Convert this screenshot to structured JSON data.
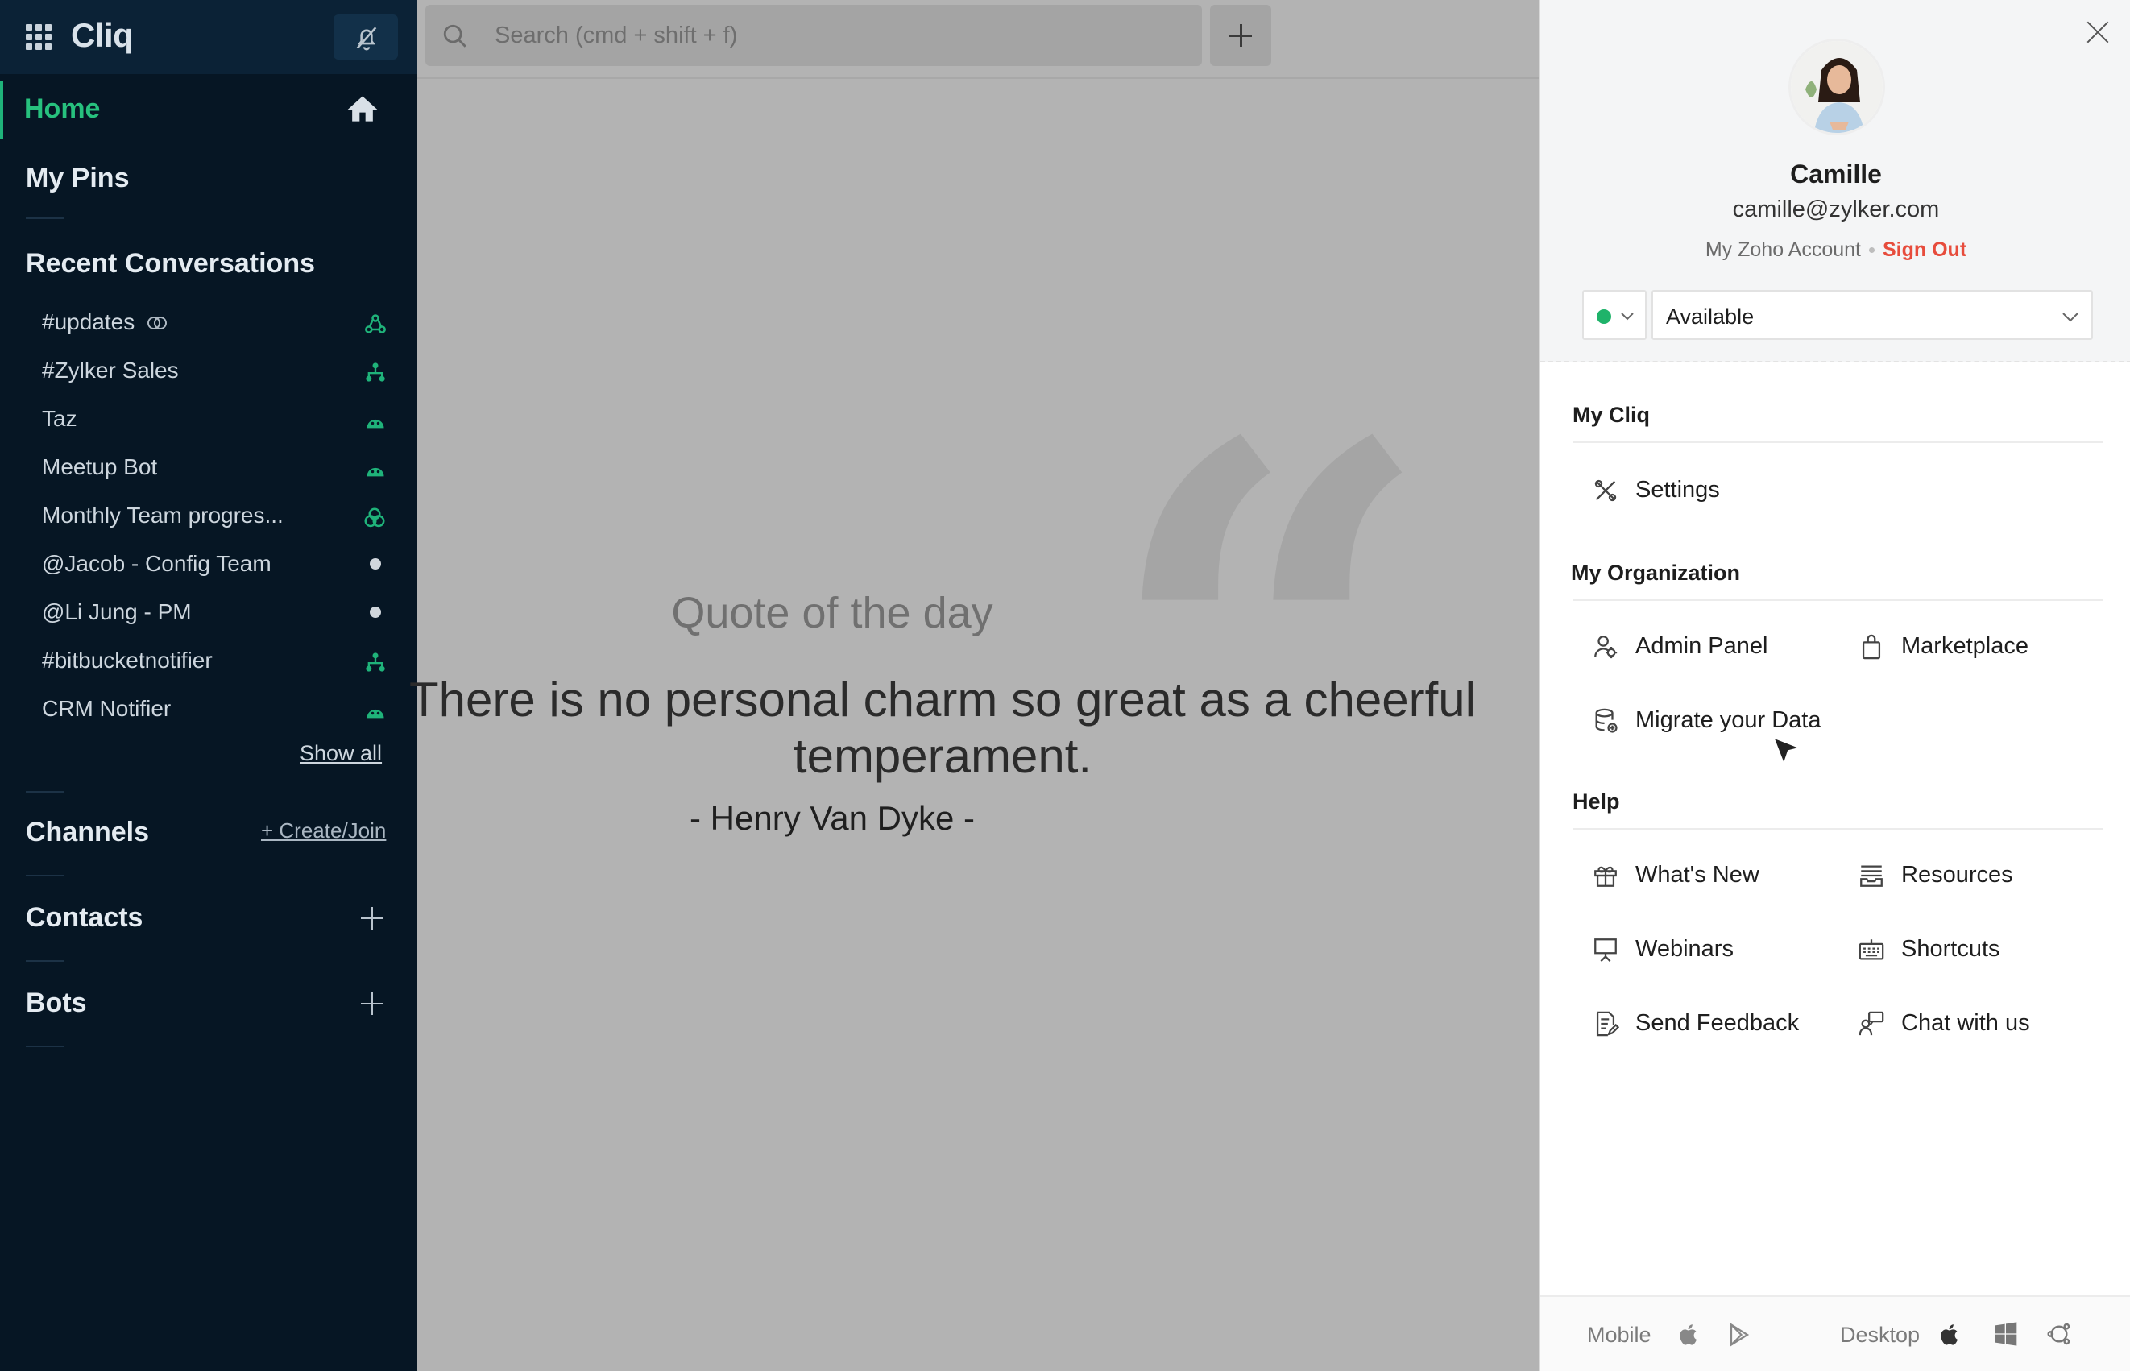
{
  "app": {
    "brand": "Cliq"
  },
  "sidebar": {
    "home_label": "Home",
    "pins_label": "My Pins",
    "recent_title": "Recent Conversations",
    "conversations": [
      {
        "label": "#updates",
        "icon": "channel-icon"
      },
      {
        "label": "#Zylker Sales",
        "icon": "org-channel-icon"
      },
      {
        "label": "Taz",
        "icon": "bot-icon"
      },
      {
        "label": "Meetup Bot",
        "icon": "bot-icon"
      },
      {
        "label": "Monthly Team progres...",
        "icon": "group-icon"
      },
      {
        "label": "@Jacob - Config Team",
        "icon": "offline-dot"
      },
      {
        "label": "@Li Jung - PM",
        "icon": "offline-dot"
      },
      {
        "label": "#bitbucketnotifier",
        "icon": "org-channel-icon"
      },
      {
        "label": "CRM Notifier",
        "icon": "bot-icon"
      }
    ],
    "show_all": "Show all",
    "channels_title": "Channels",
    "create_join": "+ Create/Join",
    "contacts_title": "Contacts",
    "bots_title": "Bots"
  },
  "search": {
    "placeholder": "Search (cmd + shift + f)"
  },
  "quote": {
    "label": "Quote of the day",
    "text": "There is no personal charm so great as a cheerful temperament.",
    "author": "- Henry Van Dyke -"
  },
  "profile": {
    "name": "Camille",
    "email": "camille@zylker.com",
    "account_link": "My Zoho Account",
    "sign_out": "Sign Out",
    "status": "Available",
    "status_color": "#1fb36a"
  },
  "menu": {
    "my_cliq_title": "My Cliq",
    "settings": "Settings",
    "org_title": "My Organization",
    "admin_panel": "Admin Panel",
    "marketplace": "Marketplace",
    "migrate": "Migrate your Data",
    "help_title": "Help",
    "whats_new": "What's New",
    "resources": "Resources",
    "webinars": "Webinars",
    "shortcuts": "Shortcuts",
    "send_feedback": "Send Feedback",
    "chat_with_us": "Chat with us"
  },
  "footer": {
    "mobile": "Mobile",
    "desktop": "Desktop"
  },
  "colors": {
    "accent": "#27c17e",
    "sidebar_bg": "#061624",
    "sign_out": "#e74c3c"
  }
}
